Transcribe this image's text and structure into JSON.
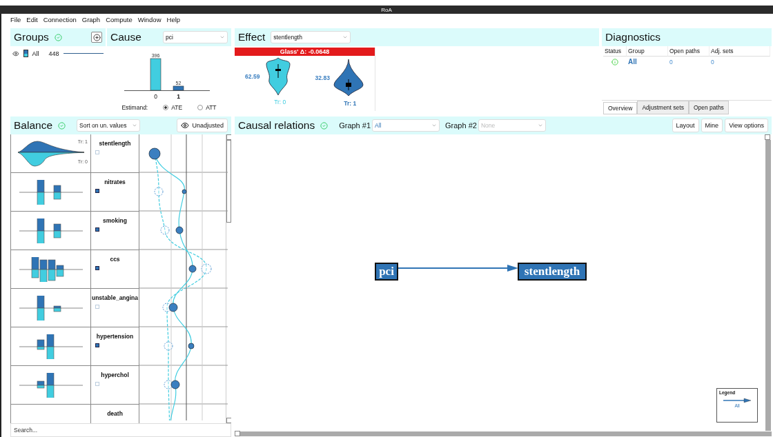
{
  "window": {
    "title": "RoA"
  },
  "menu": [
    "File",
    "Edit",
    "Connection",
    "Graph",
    "Compute",
    "Window",
    "Help"
  ],
  "groups": {
    "title": "Groups",
    "items": [
      {
        "label": "All",
        "count": "448"
      }
    ]
  },
  "cause": {
    "title": "Cause",
    "variable": "pci",
    "chart_data": {
      "type": "bar",
      "categories": [
        "0",
        "1"
      ],
      "values": [
        396,
        52
      ],
      "data_labels": true
    },
    "estimand_label": "Estimand:",
    "estimands": [
      {
        "label": "ATE",
        "selected": true
      },
      {
        "label": "ATT",
        "selected": false
      }
    ]
  },
  "effect": {
    "title": "Effect",
    "variable": "stentlength",
    "statistic": "Glass' Δ: -0.0648",
    "groups": [
      {
        "label": "Tr: 0",
        "value": "62.59",
        "color": "#41cde0"
      },
      {
        "label": "Tr: 1",
        "value": "32.83",
        "color": "#2f74b5"
      }
    ]
  },
  "diagnostics": {
    "title": "Diagnostics",
    "columns": [
      "Status",
      "Group",
      "Open paths",
      "Adj. sets"
    ],
    "rows": [
      {
        "group": "All",
        "open_paths": "0",
        "adj_sets": "0"
      }
    ],
    "tabs": [
      {
        "label": "Overview",
        "selected": true
      },
      {
        "label": "Adjustment sets",
        "selected": false
      },
      {
        "label": "Open paths",
        "selected": false
      }
    ]
  },
  "balance": {
    "title": "Balance",
    "sort": "Sort on un. values",
    "view_button": "Unadjusted",
    "search_placeholder": "Search...",
    "covariates": [
      {
        "name": "stentlength",
        "checked": false,
        "treatment_labels": [
          "Tr: 1",
          "Tr: 0"
        ]
      },
      {
        "name": "nitrates",
        "checked": true
      },
      {
        "name": "smoking",
        "checked": true
      },
      {
        "name": "ccs",
        "checked": true
      },
      {
        "name": "unstable_angina",
        "checked": false
      },
      {
        "name": "hypertension",
        "checked": true
      },
      {
        "name": "hyperchol",
        "checked": false
      },
      {
        "name": "death"
      }
    ]
  },
  "causal": {
    "title": "Causal relations",
    "graph1_label": "Graph #1",
    "graph1": "All",
    "graph2_label": "Graph #2",
    "graph2_placeholder": "None",
    "buttons": [
      "Layout",
      "Mine",
      "View options"
    ],
    "nodes": [
      {
        "label": "pci"
      },
      {
        "label": "stentlength"
      }
    ],
    "legend": {
      "title": "Legend",
      "label": "All"
    }
  }
}
